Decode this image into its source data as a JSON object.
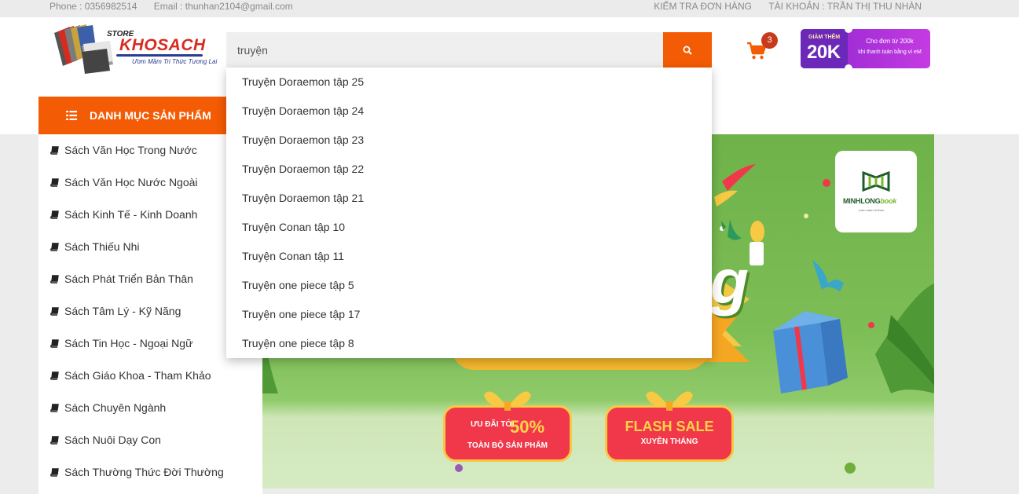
{
  "topbar": {
    "phone": "Phone : 0356982514",
    "email": "Email : thunhan2104@gmail.com",
    "check_order": "KIỂM TRA ĐƠN HÀNG",
    "account": "TÀI KHOẢN : TRẦN THỊ THU NHÀN"
  },
  "logo": {
    "store": "STORE",
    "brand": "KHOSACH",
    "slogan": "Ươm Mầm Tri Thức Tương Lai"
  },
  "search": {
    "value": "truyện",
    "icon": "search-icon"
  },
  "cart": {
    "count": "3",
    "icon": "shopping-cart-icon"
  },
  "promo": {
    "label_small": "GIẢM THÊM",
    "label_big": "20K",
    "line1": "Cho đơn từ 200k",
    "line2": "khi thanh toán bằng ví eM"
  },
  "category": {
    "header": "DANH MỤC SẢN PHẨM",
    "items": [
      "Sách Văn Học Trong Nước",
      "Sách Văn Học Nước Ngoài",
      "Sách Kinh Tế - Kinh Doanh",
      "Sách Thiếu Nhi",
      "Sách Phát Triển Bản Thân",
      "Sách Tâm Lý - Kỹ Năng",
      "Sách Tin Học - Ngoại Ngữ",
      "Sách Giáo Khoa - Tham Khảo",
      "Sách Chuyên Ngành",
      "Sách Nuôi Dạy Con",
      "Sách Thường Thức Đời Thường"
    ]
  },
  "suggestions": [
    "Truyện Doraemon tập 25",
    "Truyện Doraemon tập 24",
    "Truyện Doraemon tập 23",
    "Truyện Doraemon tập 22",
    "Truyện Doraemon tập 21",
    "Truyện Conan tập 10",
    "Truyện Conan tập 11",
    "Truyện one piece tập 5",
    "Truyện one piece tập 17",
    "Truyện one piece tập 8"
  ],
  "banner": {
    "partner_logo": "MINHLONG",
    "partner_logo_suffix": "book",
    "partner_tagline": "ươm mầm tri thức",
    "big_letter": "g",
    "deal_prefix": "ƯU ĐÃI TỚI",
    "deal_percent": "50%",
    "deal_sub": "TOÀN BỘ SẢN PHẨM",
    "flash_title": "FLASH SALE",
    "flash_sub": "XUYÊN THÁNG"
  },
  "colors": {
    "accent": "#f35b04",
    "banner_green": "#7dbd55",
    "promo_purple": "#a42ed6"
  }
}
